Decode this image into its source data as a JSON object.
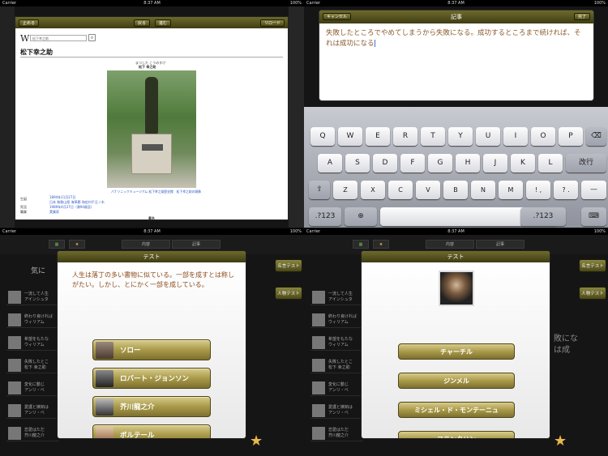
{
  "status": {
    "carrier": "Carrier",
    "time": "8:37 AM",
    "battery": "100%"
  },
  "q1": {
    "toolbar": {
      "stop": "止める",
      "back": "戻る",
      "forward": "進む",
      "reload": "リロード"
    },
    "search_placeholder": "松下幸之助",
    "page_title": "松下幸之助",
    "caption_top": "まつした こうのすけ",
    "caption_name": "松下 幸之助",
    "photo_caption": "パナソニックミュージアム 松下幸之助歴史館　松下幸之助の銅像",
    "info_labels": [
      "生誕",
      "死没",
      "職業"
    ],
    "info_values": [
      "1894年11月27日",
      "日本 和歌山県 海草郡 和佐村千旦ノ木",
      "1989年4月27日（満94歳没）",
      "実業家"
    ],
    "footer": "著名"
  },
  "q2": {
    "cancel": "キャンセル",
    "title": "記事",
    "done": "完了",
    "text": "失敗したところでやめてしまうから失敗になる。成功するところまで続ければ、それは成功になる",
    "keys_row1": [
      "Q",
      "W",
      "E",
      "R",
      "T",
      "Y",
      "U",
      "I",
      "O",
      "P"
    ],
    "keys_row2": [
      "A",
      "S",
      "D",
      "F",
      "G",
      "H",
      "J",
      "K",
      "L"
    ],
    "enter": "改行",
    "keys_row3": [
      "Z",
      "X",
      "C",
      "V",
      "B",
      "N",
      "M",
      "!\n,",
      "?\n."
    ],
    "dash": "—",
    "num": ".?123"
  },
  "q3": {
    "tab_left": "内容",
    "tab_right": "記事",
    "side_name_test": "名言テスト",
    "side_person_test": "人物テスト",
    "list_header": "気に",
    "rows": [
      "一流して人生\nアインシュタ",
      "終わり良ければ\nウィリアム",
      "希望をもたな\nウィリアム",
      "失敗したとこ\n松下 幸之助",
      "変化に動じ\nアンリ・ベ",
      "愛護と嫉妬は\nアンリ・ベ",
      "恋愛はただ\n芥川龍之介"
    ],
    "dialog_title": "テスト",
    "question": "人生は落丁の多い書物に似ている。一部を成すとは称しがたい。しかし、とにかく一部を成している。",
    "answers": [
      "ソロー",
      "ロバート・ジョンソン",
      "芥川龍之介",
      "ボルテール"
    ]
  },
  "q4": {
    "dialog_title": "テスト",
    "answers": [
      "チャーチル",
      "ジンメル",
      "ミシェル・ド・モンテーニュ",
      "フランクリン"
    ],
    "bg_text": "敗にな\nは成"
  }
}
